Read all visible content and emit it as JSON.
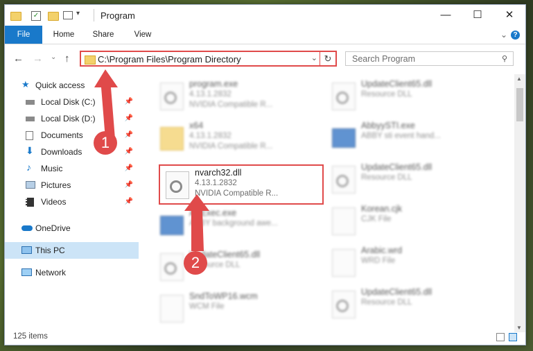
{
  "window": {
    "title": "Program",
    "minimize": "—",
    "maximize": "☐",
    "close": "✕"
  },
  "ribbon": {
    "tabs": [
      "File",
      "Home",
      "Share",
      "View"
    ],
    "expand": "⌄",
    "help": "?"
  },
  "nav": {
    "back": "←",
    "forward": "→",
    "recent": "⌄",
    "up": "↑"
  },
  "address": {
    "path": "C:\\Program Files\\Program Directory",
    "refresh": "↻",
    "dropdown": "⌄"
  },
  "search": {
    "placeholder": "Search Program"
  },
  "sidebar": {
    "items": [
      {
        "label": "Quick access",
        "icon": "star-icon"
      },
      {
        "label": "Local Disk (C:)",
        "icon": "drive-icon",
        "pinned": true
      },
      {
        "label": "Local Disk (D:)",
        "icon": "drive-icon",
        "pinned": true
      },
      {
        "label": "Documents",
        "icon": "documents-icon",
        "pinned": true
      },
      {
        "label": "Downloads",
        "icon": "download-icon",
        "pinned": true
      },
      {
        "label": "Music",
        "icon": "music-icon",
        "pinned": true
      },
      {
        "label": "Pictures",
        "icon": "pictures-icon",
        "pinned": true
      },
      {
        "label": "Videos",
        "icon": "videos-icon",
        "pinned": true
      },
      {
        "label": "OneDrive",
        "icon": "cloud-icon"
      },
      {
        "label": "This PC",
        "icon": "computer-icon"
      },
      {
        "label": "Network",
        "icon": "network-icon"
      }
    ]
  },
  "files": [
    {
      "name": "program.exe",
      "line2": "4.13.1.2832",
      "line3": "NVIDIA Compatible R..."
    },
    {
      "name": "UpdateClient65.dll",
      "line2": "Resource DLL",
      "line3": ""
    },
    {
      "name": "x64",
      "line2": "4.13.1.2832",
      "line3": "NVIDIA Compatible R..."
    },
    {
      "name": "AbbyySTI.exe",
      "line2": "ABBY sti event hand...",
      "line3": ""
    },
    {
      "name": "nvarch32.dll",
      "line2": "4.13.1.2832",
      "line3": "NVIDIA Compatible R..."
    },
    {
      "name": "UpdateClient65.dll",
      "line2": "Resource DLL",
      "line3": ""
    },
    {
      "name": "ABExec.exe",
      "line2": "ABBY background awe...",
      "line3": ""
    },
    {
      "name": "Korean.cjk",
      "line2": "CJK File",
      "line3": ""
    },
    {
      "name": "UpdateClient65.dll",
      "line2": "Resource DLL",
      "line3": ""
    },
    {
      "name": "Arabic.wrd",
      "line2": "WRD File",
      "line3": ""
    },
    {
      "name": "SndToWP16.wcm",
      "line2": "WCM File",
      "line3": ""
    },
    {
      "name": "UpdateClient65.dll",
      "line2": "Resource DLL",
      "line3": ""
    }
  ],
  "status": {
    "count": "125 items"
  },
  "annotations": {
    "step1": "1",
    "step2": "2"
  },
  "colors": {
    "accent": "#1979ca",
    "highlight": "#e04a4a",
    "selected": "#cce4f7"
  }
}
